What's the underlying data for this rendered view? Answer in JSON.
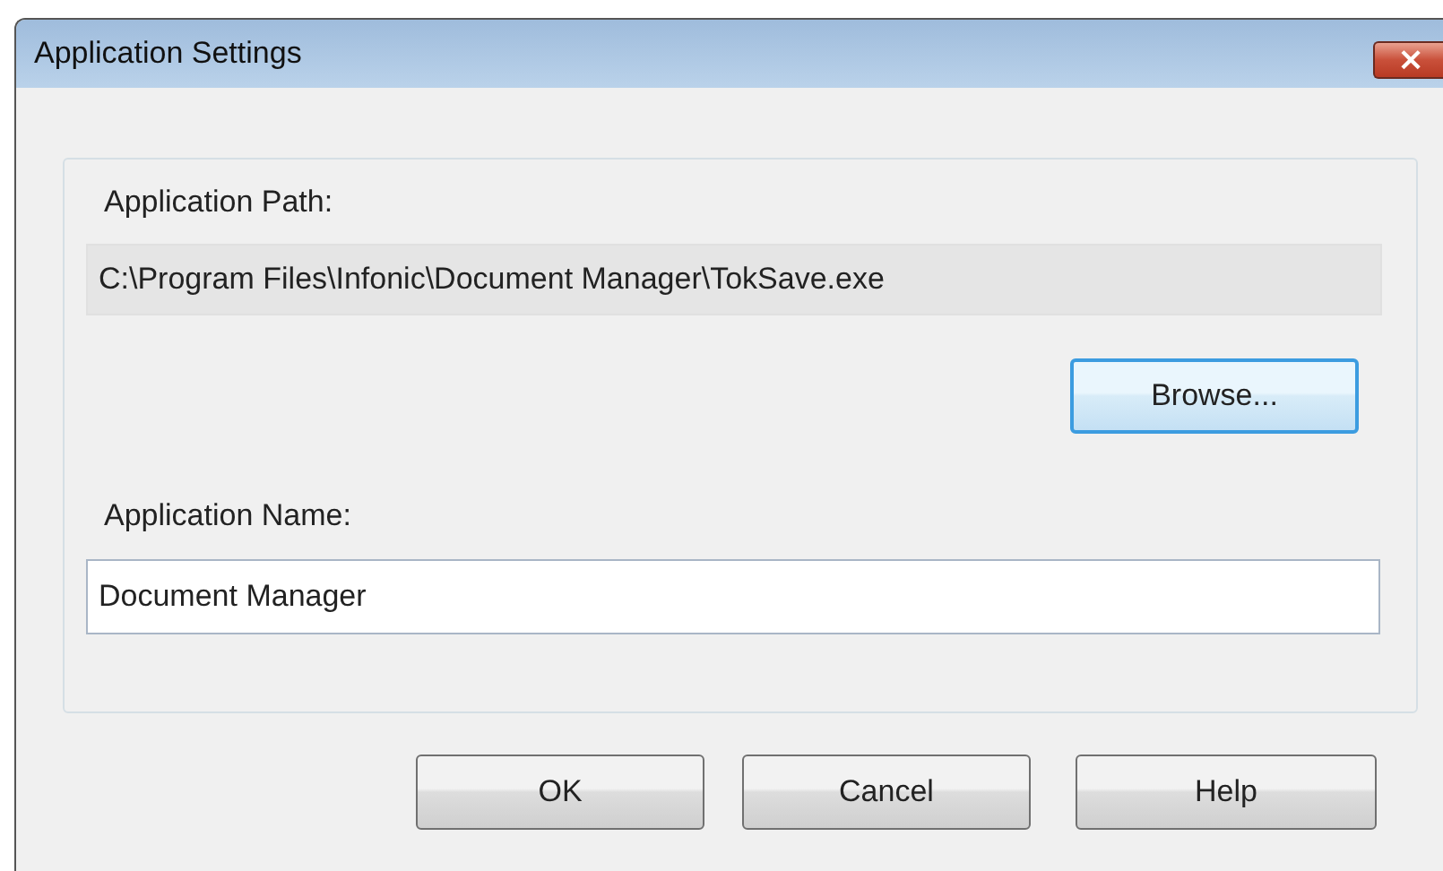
{
  "window": {
    "title": "Application Settings",
    "close": "×"
  },
  "path_label": "Application Path:",
  "path_value": "C:\\Program Files\\Infonic\\Document Manager\\TokSave.exe",
  "browse_button": {
    "label": "Browse...",
    "focused": true
  },
  "name_label": "Application Name:",
  "name_value": "Document Manager",
  "buttons": [
    {
      "label": "OK",
      "focused": false
    },
    {
      "label": "Cancel",
      "focused": false
    },
    {
      "label": "Help",
      "focused": false
    }
  ]
}
